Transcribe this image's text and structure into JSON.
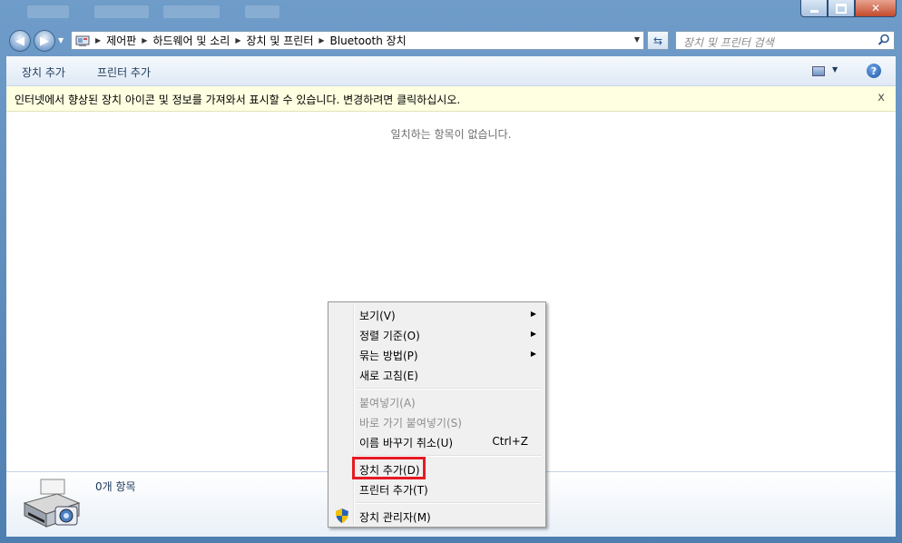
{
  "window": {
    "minimize_icon": "minimize-icon",
    "maximize_icon": "maximize-icon",
    "close_icon": "close-icon"
  },
  "nav": {
    "back_icon": "back-arrow-icon",
    "forward_icon": "forward-arrow-icon",
    "breadcrumb": [
      "제어판",
      "하드웨어 및 소리",
      "장치 및 프린터",
      "Bluetooth 장치"
    ],
    "search_placeholder": "장치 및 프린터 검색"
  },
  "toolbar": {
    "add_device": "장치 추가",
    "add_printer": "프린터 추가",
    "help_label": "?"
  },
  "infobar": {
    "message": "인터넷에서 향상된 장치 아이콘 및 정보를 가져와서 표시할 수 있습니다. 변경하려면 클릭하십시오.",
    "close_label": "x"
  },
  "main": {
    "empty_message": "일치하는 항목이 없습니다."
  },
  "details": {
    "item_count": "0개 항목",
    "icon": "printer-camera-icon"
  },
  "context_menu": {
    "items": [
      {
        "label": "보기(V)",
        "submenu": true
      },
      {
        "label": "정렬 기준(O)",
        "submenu": true
      },
      {
        "label": "묶는 방법(P)",
        "submenu": true
      },
      {
        "label": "새로 고침(E)"
      },
      {
        "label": "붙여넣기(A)",
        "disabled": true
      },
      {
        "label": "바로 가기 붙여넣기(S)",
        "disabled": true
      },
      {
        "label": "이름 바꾸기 취소(U)",
        "shortcut": "Ctrl+Z"
      },
      {
        "label": "장치 추가(D)",
        "highlighted_box": true
      },
      {
        "label": "프린터 추가(T)"
      },
      {
        "label": "장치 관리자(M)",
        "icon": "uac-shield-icon"
      }
    ]
  },
  "colors": {
    "highlight_box": "#e51b24",
    "infobar_bg": "#ffffe1",
    "frame": "#6f9cc9"
  }
}
